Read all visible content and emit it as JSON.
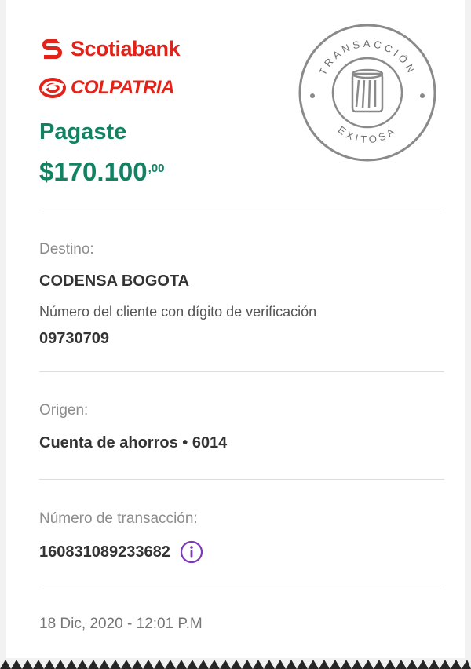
{
  "brand": {
    "primary_name": "Scotiabank",
    "secondary_name": "COLPATRIA",
    "accent_color": "#e2231a"
  },
  "summary": {
    "headline": "Pagaste",
    "amount_main": "$170.100",
    "amount_cents": ",00",
    "accent_color": "#138263"
  },
  "stamp": {
    "top_text": "TRANSACCIÓN",
    "bottom_text": "EXITOSA",
    "icon": "receipt-roll-icon"
  },
  "destination": {
    "label": "Destino:",
    "name": "CODENSA BOGOTA",
    "client_label": "Número del cliente con dígito de verificación",
    "client_number": "09730709"
  },
  "origin": {
    "label": "Origen:",
    "account": "Cuenta de ahorros • 6014"
  },
  "transaction": {
    "label": "Número de transacción:",
    "number": "160831089233682",
    "info_icon": "info-icon",
    "info_color": "#7c3ab8"
  },
  "datetime": "18 Dic, 2020 - 12:01 P.M"
}
